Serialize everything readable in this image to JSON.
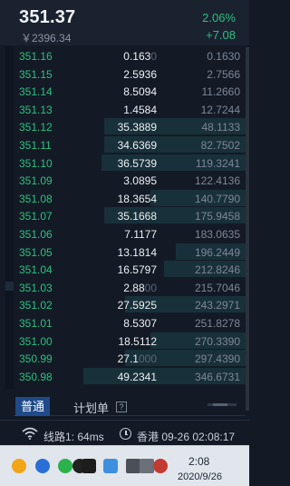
{
  "header": {
    "price": "351.37",
    "cny": "￥2396.34",
    "change_pct": "2.06%",
    "change_abs": "+7.08"
  },
  "orderbook": {
    "rows": [
      {
        "price": "351.16",
        "qty": "0.163",
        "qty_dim": "0",
        "cum": "0.1630",
        "depth": 0.0
      },
      {
        "price": "351.15",
        "qty": "2.5936",
        "qty_dim": "",
        "cum": "2.7566",
        "depth": 0.0
      },
      {
        "price": "351.14",
        "qty": "8.5094",
        "qty_dim": "",
        "cum": "11.2660",
        "depth": 0.0
      },
      {
        "price": "351.13",
        "qty": "1.4584",
        "qty_dim": "",
        "cum": "12.7244",
        "depth": 0.0
      },
      {
        "price": "351.12",
        "qty": "35.3889",
        "qty_dim": "",
        "cum": "48.1133",
        "depth": 0.61
      },
      {
        "price": "351.11",
        "qty": "34.6369",
        "qty_dim": "",
        "cum": "82.7502",
        "depth": 0.61
      },
      {
        "price": "351.10",
        "qty": "36.5739",
        "qty_dim": "",
        "cum": "119.3241",
        "depth": 0.62
      },
      {
        "price": "351.09",
        "qty": "3.0895",
        "qty_dim": "",
        "cum": "122.4136",
        "depth": 0.0
      },
      {
        "price": "351.08",
        "qty": "18.3654",
        "qty_dim": "",
        "cum": "140.7790",
        "depth": 0.41
      },
      {
        "price": "351.07",
        "qty": "35.1668",
        "qty_dim": "",
        "cum": "175.9458",
        "depth": 0.61
      },
      {
        "price": "351.06",
        "qty": "7.1177",
        "qty_dim": "",
        "cum": "183.0635",
        "depth": 0.0
      },
      {
        "price": "351.05",
        "qty": "13.1814",
        "qty_dim": "",
        "cum": "196.2449",
        "depth": 0.3
      },
      {
        "price": "351.04",
        "qty": "16.5797",
        "qty_dim": "",
        "cum": "212.8246",
        "depth": 0.35
      },
      {
        "price": "351.03",
        "qty": "2.88",
        "qty_dim": "00",
        "cum": "215.7046",
        "depth": 0.0
      },
      {
        "price": "351.02",
        "qty": "27.5925",
        "qty_dim": "",
        "cum": "243.2971",
        "depth": 0.52
      },
      {
        "price": "351.01",
        "qty": "8.5307",
        "qty_dim": "",
        "cum": "251.8278",
        "depth": 0.0
      },
      {
        "price": "351.00",
        "qty": "18.5112",
        "qty_dim": "",
        "cum": "270.3390",
        "depth": 0.41
      },
      {
        "price": "350.99",
        "qty": "27.1",
        "qty_dim": "000",
        "cum": "297.4390",
        "depth": 0.52
      },
      {
        "price": "350.98",
        "qty": "49.2341",
        "qty_dim": "",
        "cum": "346.6731",
        "depth": 0.7
      }
    ]
  },
  "tabs": {
    "normal": "普通",
    "plan": "计划单",
    "help": "?"
  },
  "status": {
    "line": "线路1: 64ms",
    "time": "香港 09-26 02:08:17"
  },
  "taskbar": {
    "time": "2:08",
    "date": "2020/9/26",
    "tray_icons": [
      "baidu-netdisk-icon",
      "blue-circle-app-icon",
      "wechat-icon",
      "qq-icon",
      "tp-app-icon",
      "cloud-icon",
      "clipboard-icon",
      "battery-icon",
      "volume-muted-icon"
    ],
    "colors": {
      "up_green": "#2fbf7d",
      "accent_blue": "#1f4a89",
      "panel_bg": "#131a26"
    }
  }
}
